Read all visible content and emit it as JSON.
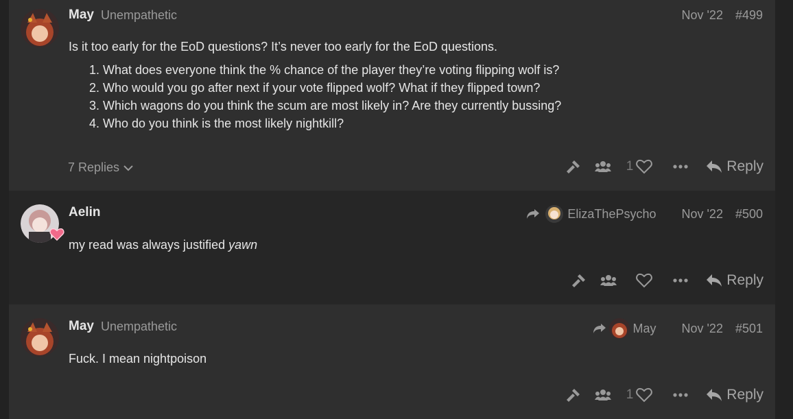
{
  "posts": [
    {
      "author": "May",
      "user_title": "Unempathetic",
      "date": "Nov '22",
      "number": "#499",
      "intro": "Is it too early for the EoD questions? It’s never too early for the EoD questions.",
      "list": [
        "What does everyone think the % chance of the player they’re voting flipping wolf is?",
        "Who would you go after next if your vote flipped wolf? What if they flipped town?",
        "Which wagons do you think the scum are most likely in? Are they currently bussing?",
        "Who do you think is the most likely nightkill?"
      ],
      "replies_label": "7 Replies",
      "like_count": "1",
      "reply_label": "Reply"
    },
    {
      "author": "Aelin",
      "reply_to": "ElizaThePsycho",
      "date": "Nov '22",
      "number": "#500",
      "text_plain": "my read was always justified ",
      "text_italic": "yawn",
      "reply_label": "Reply"
    },
    {
      "author": "May",
      "user_title": "Unempathetic",
      "reply_to": "May",
      "date": "Nov '22",
      "number": "#501",
      "text": "Fuck. I mean nightpoison",
      "like_count": "1",
      "reply_label": "Reply"
    }
  ],
  "icons": {
    "flag": "gavel-icon",
    "group": "users-icon",
    "like": "heart-icon",
    "more": "ellipsis-icon",
    "reply": "reply-arrow-icon",
    "expand": "chevron-down-icon",
    "reply_to": "share-arrow-icon"
  }
}
